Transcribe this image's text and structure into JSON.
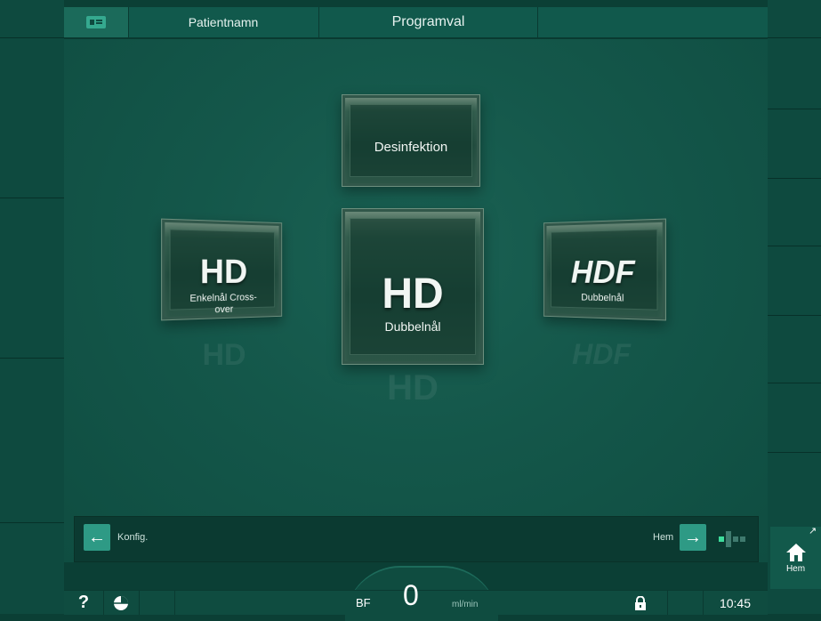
{
  "header": {
    "patient_name_label": "Patientnamn",
    "screen_title": "Programval",
    "patient_card_icon": "patient-card-icon"
  },
  "programs": {
    "disinfection": {
      "label": "Desinfektion"
    },
    "hd_single_needle": {
      "big": "HD",
      "sub": "Enkelnål Cross-over"
    },
    "hd_double_needle": {
      "big": "HD",
      "sub": "Dubbelnål"
    },
    "hdf_double_needle": {
      "big": "HDF",
      "sub": "Dubbelnål"
    }
  },
  "nav": {
    "back_label": "Konfig.",
    "forward_label": "Hem",
    "back_icon": "arrow-left-icon",
    "forward_icon": "arrow-right-icon",
    "progress_icon": "progress-dots-icon"
  },
  "status": {
    "help_glyph": "?",
    "bf_label": "BF",
    "bf_value": "0",
    "bf_unit": "ml/min",
    "time": "10:45",
    "lock_icon": "lock-icon",
    "timer_icon": "timer-icon",
    "help_icon": "help-icon"
  },
  "side": {
    "home_label": "Hem",
    "home_icon": "home-icon",
    "expand_icon": "expand-arrow-icon"
  },
  "colors": {
    "accent": "#2e9a85",
    "background": "#0b3f35",
    "progress_active": "#3ddc9b"
  }
}
